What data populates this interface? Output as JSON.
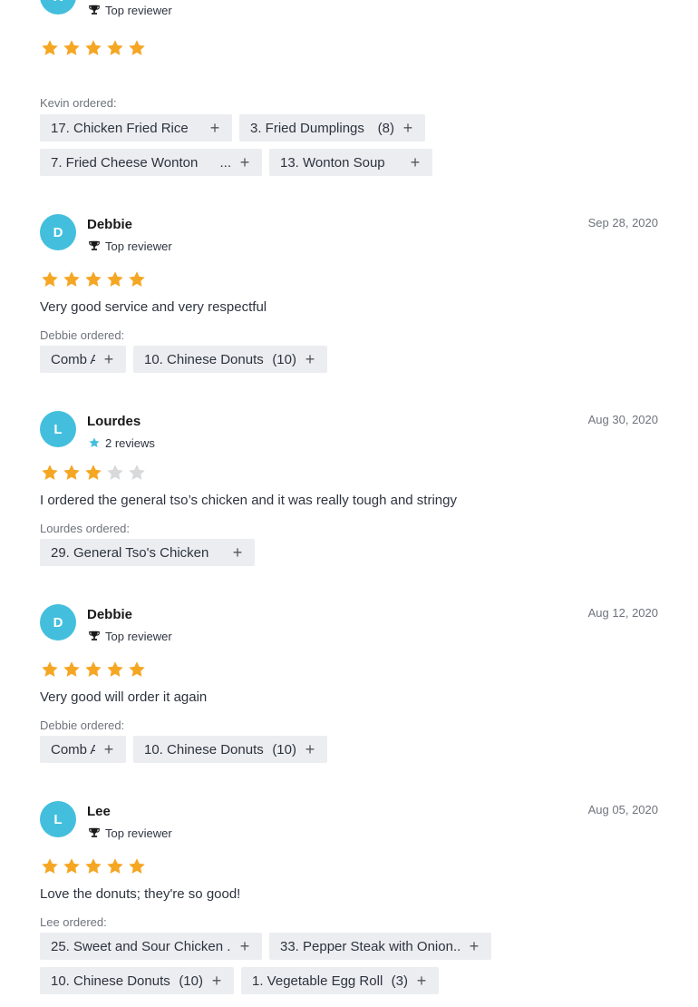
{
  "colors": {
    "accent": "#43bfdd",
    "star_filled": "#f5a623",
    "star_empty": "#d8d9db",
    "chip_bg": "#ebedf0"
  },
  "reviews": [
    {
      "initial": "K",
      "name": "",
      "badge_icon": "trophy-icon",
      "badge": "Top reviewer",
      "date": "",
      "rating": 5,
      "text": "",
      "ordered_label": "Kevin ordered:",
      "items": [
        {
          "label": "17. Chicken Fried Rice",
          "qty": ""
        },
        {
          "label": "3. Fried Dumplings",
          "qty": "(8)"
        },
        {
          "label": "7. Fried Cheese Wonton",
          "qty": "..."
        },
        {
          "label": "13. Wonton Soup",
          "qty": ""
        }
      ]
    },
    {
      "initial": "D",
      "name": "Debbie",
      "badge_icon": "trophy-icon",
      "badge": "Top reviewer",
      "date": "Sep 28, 2020",
      "rating": 5,
      "text": "Very good service and very respectful",
      "ordered_label": "Debbie ordered:",
      "items": [
        {
          "label": "Comb A",
          "qty": ""
        },
        {
          "label": "10. Chinese Donuts",
          "qty": "(10)"
        }
      ]
    },
    {
      "initial": "L",
      "name": "Lourdes",
      "badge_icon": "star-icon",
      "badge": "2 reviews",
      "date": "Aug 30, 2020",
      "rating": 3,
      "text": "I ordered the general tso’s chicken and it was really tough and stringy",
      "ordered_label": "Lourdes ordered:",
      "items": [
        {
          "label": "29. General Tso's Chicken",
          "qty": ""
        }
      ]
    },
    {
      "initial": "D",
      "name": "Debbie",
      "badge_icon": "trophy-icon",
      "badge": "Top reviewer",
      "date": "Aug 12, 2020",
      "rating": 5,
      "text": "Very good will order it again",
      "ordered_label": "Debbie ordered:",
      "items": [
        {
          "label": "Comb A",
          "qty": ""
        },
        {
          "label": "10. Chinese Donuts",
          "qty": "(10)"
        }
      ]
    },
    {
      "initial": "L",
      "name": "Lee",
      "badge_icon": "trophy-icon",
      "badge": "Top reviewer",
      "date": "Aug 05, 2020",
      "rating": 5,
      "text": "Love the donuts; they're so good!",
      "ordered_label": "Lee ordered:",
      "items": [
        {
          "label": "25. Sweet and Sour Chicken ...",
          "qty": ""
        },
        {
          "label": "33. Pepper Steak with Onion...",
          "qty": ""
        },
        {
          "label": "10. Chinese Donuts",
          "qty": "(10)"
        },
        {
          "label": "1. Vegetable Egg Roll",
          "qty": "(3)"
        }
      ]
    }
  ]
}
